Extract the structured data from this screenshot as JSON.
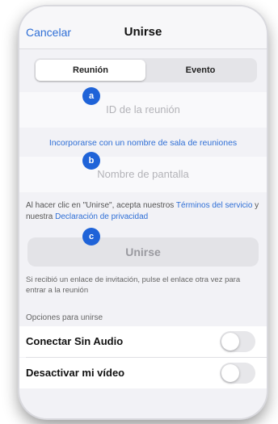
{
  "nav": {
    "cancel": "Cancelar",
    "title": "Unirse"
  },
  "segments": [
    {
      "label": "Reunión",
      "selected": true
    },
    {
      "label": "Evento",
      "selected": false
    }
  ],
  "meeting_id": {
    "placeholder": "ID de la reunión",
    "marker": "a"
  },
  "room_link": "Incorporarse con un nombre de sala de reuniones",
  "display_name": {
    "placeholder": "Nombre de pantalla",
    "marker": "b"
  },
  "terms": {
    "prefix": "Al hacer clic en \"Unirse\", acepta nuestros ",
    "link1": "Términos del servicio",
    "middle": " y nuestra ",
    "link2": "Declaración de privacidad"
  },
  "join_button": {
    "label": "Unirse",
    "marker": "c"
  },
  "invite_hint": "Si recibió un enlace de invitación, pulse el enlace otra vez para entrar a la reunión",
  "options_header": "Opciones para unirse",
  "options": [
    {
      "label": "Conectar Sin Audio",
      "enabled": false
    },
    {
      "label": "Desactivar mi vídeo",
      "enabled": false
    }
  ],
  "colors": {
    "accent": "#2f6fd6",
    "marker": "#1f63d8"
  }
}
